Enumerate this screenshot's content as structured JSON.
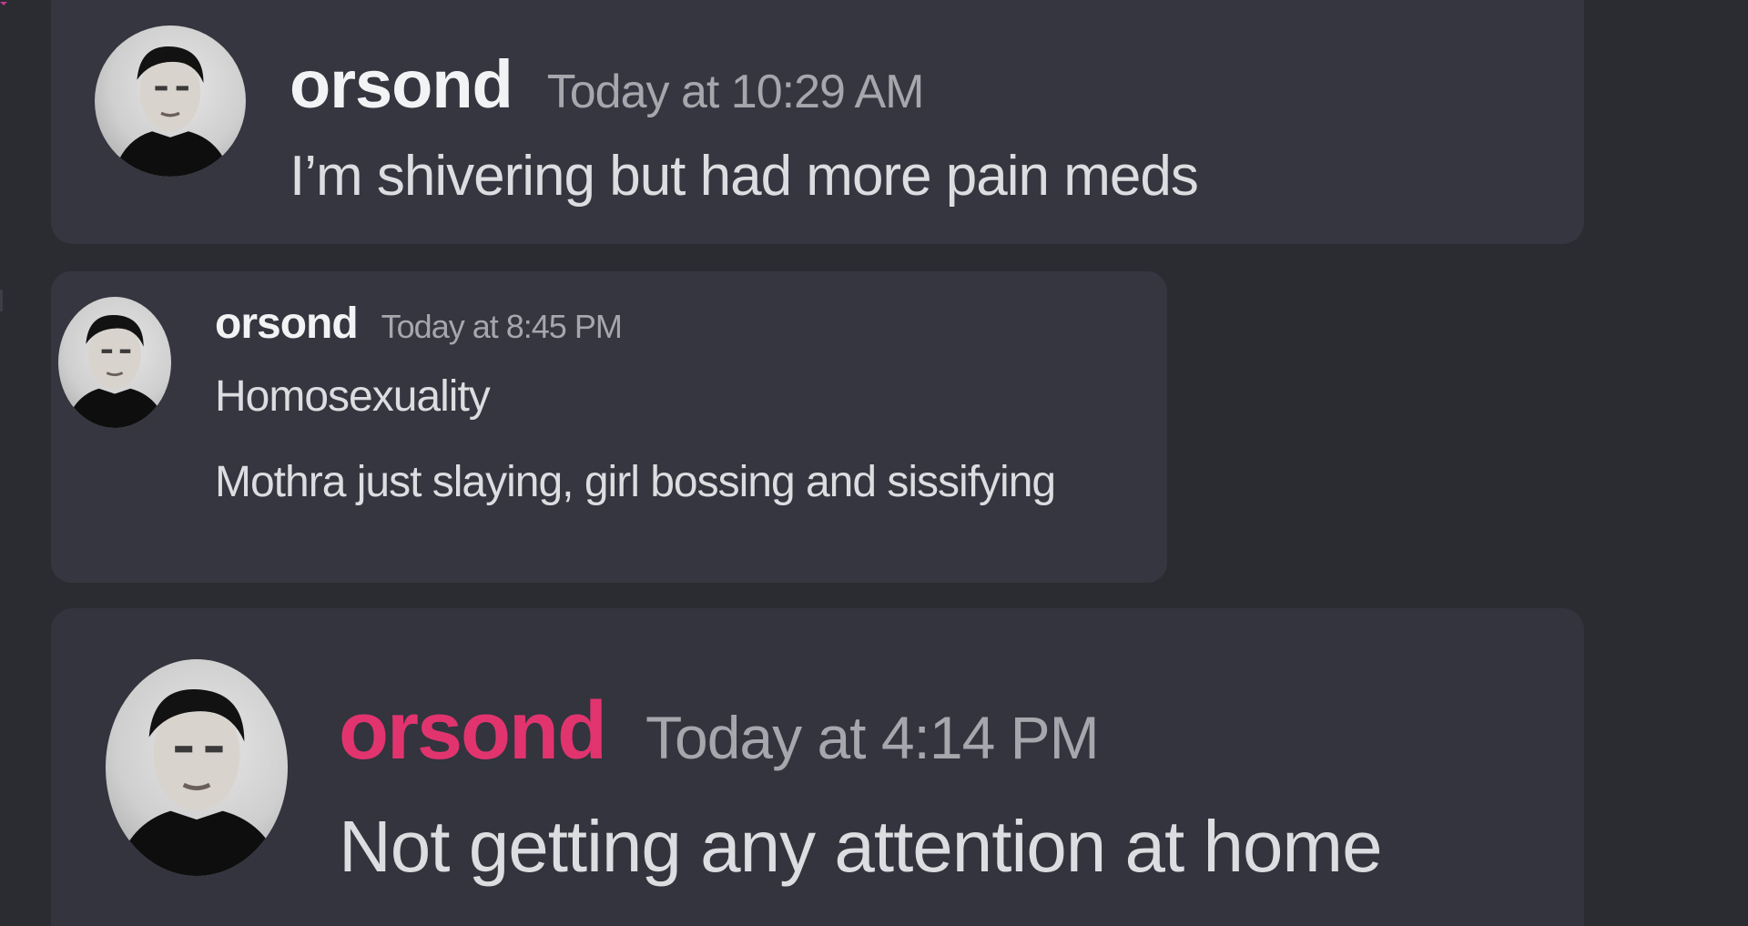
{
  "theme": {
    "background": "#2b2c32",
    "card_background": "#35363f",
    "username_color": "#f2f3f5",
    "highlight_username_color": "#e1346f",
    "timestamp_color": "#a5a7ad",
    "text_color": "#dcdde0"
  },
  "messages": [
    {
      "avatar_icon": "user-avatar-portrait-icon",
      "username": "orsond",
      "timestamp": "Today at 10:29 AM",
      "lines": [
        "I’m shivering but had more pain meds"
      ]
    },
    {
      "avatar_icon": "user-avatar-portrait-icon",
      "username": "orsond",
      "timestamp": "Today at 8:45 PM",
      "lines": [
        "Homosexuality",
        "Mothra just slaying, girl bossing and sissifying"
      ]
    },
    {
      "avatar_icon": "user-avatar-portrait-icon",
      "username": "orsond",
      "timestamp": "Today at 4:14 PM",
      "lines": [
        "Not getting any attention at home"
      ]
    }
  ]
}
